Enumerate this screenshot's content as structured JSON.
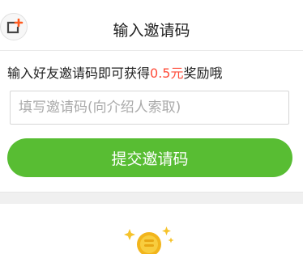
{
  "header": {
    "title": "输入邀请码",
    "back_icon": "back-with-badge-icon"
  },
  "info": {
    "prefix": "输入好友邀请码即可获得",
    "amount": "0.5元",
    "suffix": "奖励哦",
    "amount_color": "#ff4d3a"
  },
  "code_input": {
    "placeholder": "填写邀请码(向介绍人索取)",
    "value": ""
  },
  "submit": {
    "label": "提交邀请码",
    "color": "#58bd33"
  },
  "reward": {
    "icon": "gold-coin-icon"
  }
}
